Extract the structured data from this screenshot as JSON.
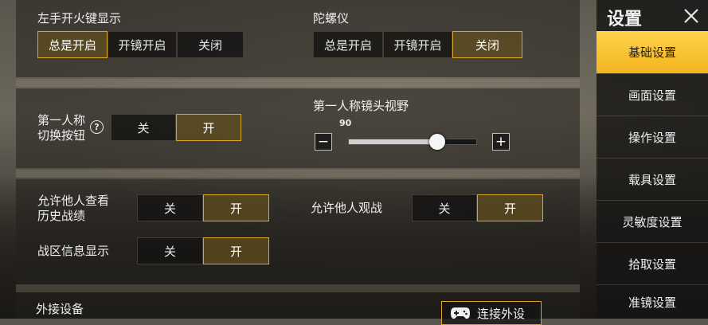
{
  "rows": {
    "left_fire": {
      "label": "左手开火键显示",
      "options": [
        "总是开启",
        "开镜开启",
        "关闭"
      ],
      "selected": 0
    },
    "gyro": {
      "label": "陀螺仪",
      "options": [
        "总是开启",
        "开镜开启",
        "关闭"
      ],
      "selected": 2
    },
    "fpp_switch": {
      "label_line1": "第一人称",
      "label_line2": "切换按钮",
      "help": "?",
      "options": [
        "关",
        "开"
      ],
      "selected": 1
    },
    "fov": {
      "label": "第一人称镜头视野",
      "value": "90",
      "minus": "−",
      "plus": "+",
      "level_pct": 70
    },
    "history": {
      "label_line1": "允许他人查看",
      "label_line2": "历史战绩",
      "options": [
        "关",
        "开"
      ],
      "selected": 1
    },
    "spectate": {
      "label": "允许他人观战",
      "options": [
        "关",
        "开"
      ],
      "selected": 1
    },
    "zone_info": {
      "label": "战区信息显示",
      "options": [
        "关",
        "开"
      ],
      "selected": 1
    },
    "external": {
      "label": "外接设备",
      "button": "连接外设"
    }
  },
  "sidebar": {
    "title": "设置",
    "items": [
      "基础设置",
      "画面设置",
      "操作设置",
      "载具设置",
      "灵敏度设置",
      "拾取设置",
      "准镜设置"
    ],
    "active": 0
  },
  "colors": {
    "accent": "#d9a723",
    "active_menu": "#f6be2a"
  }
}
